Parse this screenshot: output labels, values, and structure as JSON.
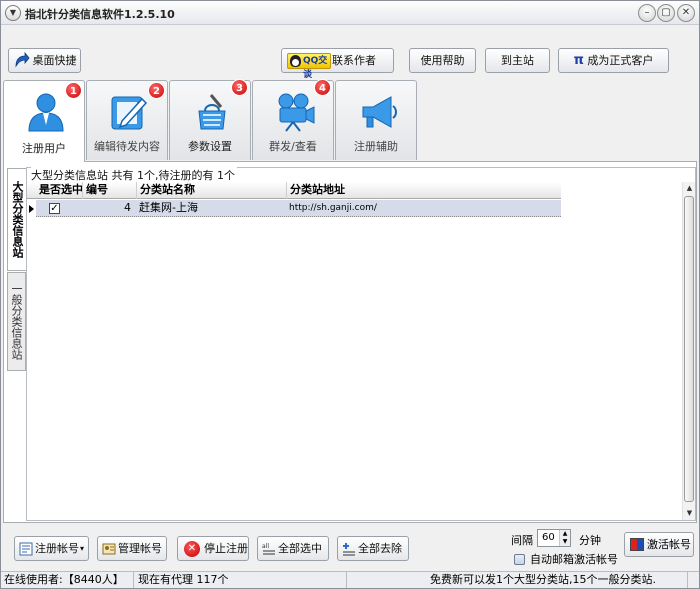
{
  "window": {
    "title": "指北针分类信息软件1.2.5.10",
    "sysmenu_glyph": "▼",
    "min": "–",
    "max": "▢",
    "close": "✕"
  },
  "toolbar": {
    "desktop_shortcut": "桌面快捷",
    "qq_badge": "QQ交谈",
    "contact_author": "联系作者",
    "help": "使用帮助",
    "home": "到主站",
    "vip_symbol": "π",
    "become_customer": "成为正式客户"
  },
  "tabs": [
    {
      "label": "注册用户",
      "badge": "1"
    },
    {
      "label": "编辑待发内容",
      "badge": "2"
    },
    {
      "label": "参数设置",
      "badge": "3"
    },
    {
      "label": "群发/查看",
      "badge": "4"
    },
    {
      "label": "注册辅助",
      "badge": ""
    }
  ],
  "side_tabs": {
    "large": "大型分类信息站",
    "general": "一般分类信息站"
  },
  "group_caption": "大型分类信息站 共有 1个,待注册的有 1个",
  "grid": {
    "columns": [
      "是否选中",
      "编号",
      "分类站名称",
      "分类站地址"
    ],
    "rows": [
      {
        "checked": "✓",
        "id": "4",
        "name": "赶集网-上海",
        "url": "http://sh.ganji.com/"
      }
    ]
  },
  "bottom": {
    "register_account": "注册帐号",
    "dropdown": "▾",
    "manage_account": "管理帐号",
    "stop_register": "停止注册",
    "stop_glyph": "✕",
    "select_all": "全部选中",
    "deselect_all": "全部去除",
    "interval_label": "间隔",
    "interval_value": "60",
    "minutes": "分钟",
    "auto_activate": "自动邮箱激活帐号",
    "activate_account": "激活帐号"
  },
  "status": {
    "online_users": "在线使用者:【8440人】",
    "agents": "现在有代理 117个",
    "notice": "免费新可以发1个大型分类站,15个一般分类站."
  }
}
